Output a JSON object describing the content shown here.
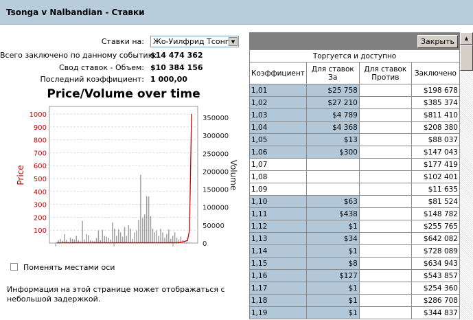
{
  "title": "Tsonga v Nalbandian - Ставки",
  "bets_on": {
    "label": "Ставки на:",
    "value": "Жо-Уилфрид Тсонга"
  },
  "stats": [
    {
      "label": "Всего заключено по данному событию:",
      "value": "$14 474 362"
    },
    {
      "label": "Свод ставок - Объем:",
      "value": "$10 384 156"
    },
    {
      "label": "Последний коэффициент:",
      "value": "1 000,00"
    }
  ],
  "swap_axes": {
    "label": "Поменять местами оси",
    "checked": false
  },
  "notice": "Информация на этой странице может отображаться с небольшой задержкой.",
  "table": {
    "close_label": "Закрыть",
    "group_header": "Торгуется и доступно",
    "columns": [
      "Коэффициент",
      "Для ставок За",
      "Для ставок Против",
      "Заключено"
    ],
    "rows": [
      {
        "odds": "1,01",
        "back": "$25 758",
        "lay": "",
        "matched": "$198 678"
      },
      {
        "odds": "1,02",
        "back": "$27 210",
        "lay": "",
        "matched": "$385 374"
      },
      {
        "odds": "1,03",
        "back": "$4 789",
        "lay": "",
        "matched": "$811 410"
      },
      {
        "odds": "1,04",
        "back": "$4 368",
        "lay": "",
        "matched": "$208 380"
      },
      {
        "odds": "1,05",
        "back": "$13",
        "lay": "",
        "matched": "$88 037"
      },
      {
        "odds": "1,06",
        "back": "$300",
        "lay": "",
        "matched": "$147 043"
      },
      {
        "odds": "1,07",
        "back": "",
        "lay": "",
        "matched": "$177 419"
      },
      {
        "odds": "1,08",
        "back": "",
        "lay": "",
        "matched": "$102 401"
      },
      {
        "odds": "1,09",
        "back": "",
        "lay": "",
        "matched": "$11 635"
      },
      {
        "odds": "1,10",
        "back": "$63",
        "lay": "",
        "matched": "$81 524"
      },
      {
        "odds": "1,11",
        "back": "$438",
        "lay": "",
        "matched": "$148 782"
      },
      {
        "odds": "1,12",
        "back": "$1",
        "lay": "",
        "matched": "$255 765"
      },
      {
        "odds": "1,13",
        "back": "$34",
        "lay": "",
        "matched": "$642 082"
      },
      {
        "odds": "1,14",
        "back": "$1",
        "lay": "",
        "matched": "$728 089"
      },
      {
        "odds": "1,15",
        "back": "$8",
        "lay": "",
        "matched": "$634 943"
      },
      {
        "odds": "1,16",
        "back": "$127",
        "lay": "",
        "matched": "$543 857"
      },
      {
        "odds": "1,17",
        "back": "$1",
        "lay": "",
        "matched": "$254 360"
      },
      {
        "odds": "1,18",
        "back": "$1",
        "lay": "",
        "matched": "$286 708"
      },
      {
        "odds": "1,19",
        "back": "$1",
        "lay": "",
        "matched": "$344 837"
      }
    ]
  },
  "chart_data": {
    "type": "line",
    "title": "Price/Volume over time",
    "ylabel": "Price",
    "y2label": "Volume",
    "ylim": [
      0,
      1000
    ],
    "y2lim": [
      0,
      350000
    ],
    "yticks": [
      "100",
      "200",
      "300",
      "400",
      "500",
      "600",
      "700",
      "800",
      "900",
      "1000"
    ],
    "y2ticks": [
      "0",
      "50000",
      "100000",
      "150000",
      "200000",
      "250000",
      "300000",
      "350000"
    ],
    "grid": true,
    "price_color": "#cc0000",
    "volume_color": "#888888",
    "volume": [
      3000,
      8000,
      12000,
      6000,
      25000,
      9000,
      4000,
      15000,
      12000,
      10000,
      20000,
      8000,
      5000,
      62000,
      10000,
      25000,
      22000,
      8000,
      6000,
      5000,
      14000,
      35000,
      8000,
      37000,
      20000,
      18000,
      15000,
      10000,
      58000,
      40000,
      20000,
      38000,
      30000,
      18000,
      45000,
      20000,
      50000,
      40000,
      12000,
      30000,
      35000,
      65000,
      190000,
      70000,
      80000,
      130000,
      130000,
      75000,
      40000,
      30000,
      35000,
      20000,
      40000,
      30000,
      15000,
      25000,
      38000,
      12000,
      20000,
      30000,
      15000,
      10000,
      18000,
      8000,
      5000,
      3000,
      2000,
      1000
    ],
    "price": [
      2,
      2,
      2,
      3,
      3,
      3,
      2,
      2,
      3,
      3,
      3,
      3,
      3,
      3,
      3,
      3,
      3,
      3,
      3,
      3,
      3,
      3,
      3,
      3,
      3,
      3,
      3,
      3,
      3,
      3,
      3,
      3,
      3,
      3,
      3,
      3,
      3,
      3,
      3,
      3,
      3,
      3,
      3,
      3,
      3,
      3,
      3,
      3,
      3,
      3,
      3,
      3,
      3,
      3,
      3,
      3,
      3,
      3,
      3,
      3,
      3,
      5,
      8,
      10,
      15,
      20,
      100,
      1000
    ]
  }
}
